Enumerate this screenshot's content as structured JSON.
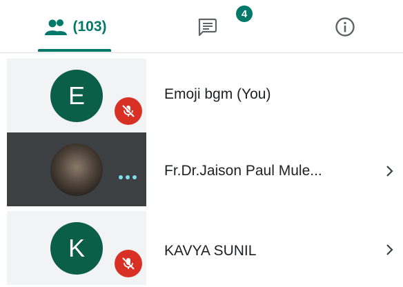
{
  "tabs": {
    "people": {
      "count_label": "(103)",
      "icon": "people-icon",
      "active": true
    },
    "chat": {
      "icon": "chat-icon",
      "badge": "4"
    },
    "info": {
      "icon": "info-icon"
    }
  },
  "colors": {
    "accent": "#00796b",
    "avatar": "#0b5e48",
    "mute": "#d93025",
    "dark_tile": "#3c4043",
    "light_tile": "#f1f3f4"
  },
  "participants": [
    {
      "initial": "E",
      "name": "Emoji bgm (You)",
      "muted": true,
      "has_chevron": false
    },
    {
      "initial": "",
      "name": "Fr.Dr.Jaison Paul Mule...",
      "muted": false,
      "speaking": true,
      "has_chevron": true
    },
    {
      "initial": "K",
      "name": "KAVYA SUNIL",
      "muted": true,
      "has_chevron": true
    }
  ]
}
